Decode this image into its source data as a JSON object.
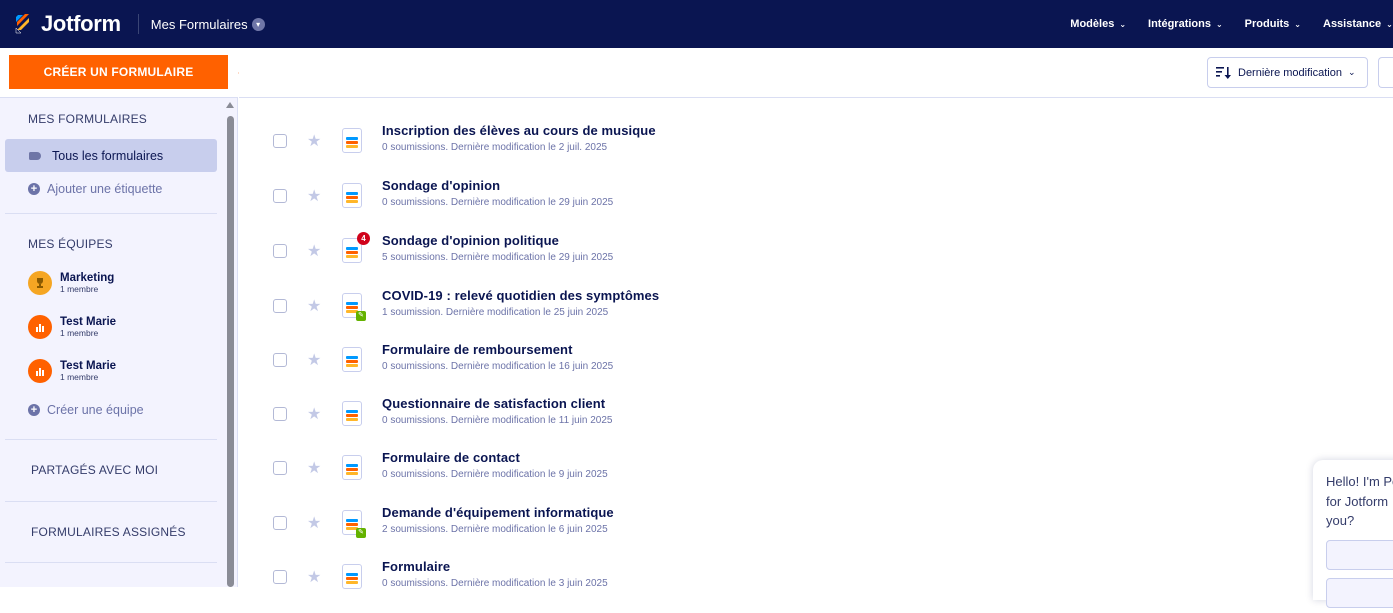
{
  "topbar": {
    "brand": "Jotform",
    "my_forms": "Mes Formulaires",
    "nav": [
      {
        "label": "Modèles"
      },
      {
        "label": "Intégrations"
      },
      {
        "label": "Produits"
      },
      {
        "label": "Assistance"
      }
    ]
  },
  "sidebar": {
    "create_button": "CRÉER UN FORMULAIRE",
    "my_forms_title": "MES FORMULAIRES",
    "all_forms": "Tous les formulaires",
    "add_label": "Ajouter une étiquette",
    "my_teams_title": "MES ÉQUIPES",
    "teams": [
      {
        "name": "Marketing",
        "members": "1 membre"
      },
      {
        "name": "Test Marie",
        "members": "1 membre"
      },
      {
        "name": "Test Marie",
        "members": "1 membre"
      }
    ],
    "create_team": "Créer une équipe",
    "shared_with_me": "PARTAGÉS AVEC MOI",
    "assigned_forms": "FORMULAIRES ASSIGNÉS"
  },
  "toolbar": {
    "sort_label": "Dernière modification"
  },
  "forms": [
    {
      "title": "Inscription des élèves au cours de musique",
      "meta": "0 soumissions. Dernière modification le 2 juil. 2025",
      "badge": null,
      "approval": false
    },
    {
      "title": "Sondage d'opinion",
      "meta": "0 soumissions. Dernière modification le 29 juin 2025",
      "badge": null,
      "approval": false
    },
    {
      "title": "Sondage d'opinion politique",
      "meta": "5 soumissions. Dernière modification le 29 juin 2025",
      "badge": "4",
      "approval": false
    },
    {
      "title": "COVID-19 : relevé quotidien des symptômes",
      "meta": "1 soumission. Dernière modification le 25 juin 2025",
      "badge": null,
      "approval": true
    },
    {
      "title": "Formulaire de remboursement",
      "meta": "0 soumissions. Dernière modification le 16 juin 2025",
      "badge": null,
      "approval": false
    },
    {
      "title": "Questionnaire de satisfaction client",
      "meta": "0 soumissions. Dernière modification le 11 juin 2025",
      "badge": null,
      "approval": false
    },
    {
      "title": "Formulaire de contact",
      "meta": "0 soumissions. Dernière modification le 9 juin 2025",
      "badge": null,
      "approval": false
    },
    {
      "title": "Demande d'équipement informatique",
      "meta": "2 soumissions. Dernière modification le 6 juin 2025",
      "badge": null,
      "approval": true
    },
    {
      "title": "Formulaire",
      "meta": "0 soumissions. Dernière modification le 3 juin 2025",
      "badge": null,
      "approval": false
    }
  ],
  "chat": {
    "text": "Hello! I'm Po\nfor Jotform\nyou?"
  },
  "colors": {
    "navy": "#0a1551",
    "orange": "#ff6100",
    "sidebar_bg": "#f3f3fe",
    "selected_bg": "#c8ceed"
  }
}
